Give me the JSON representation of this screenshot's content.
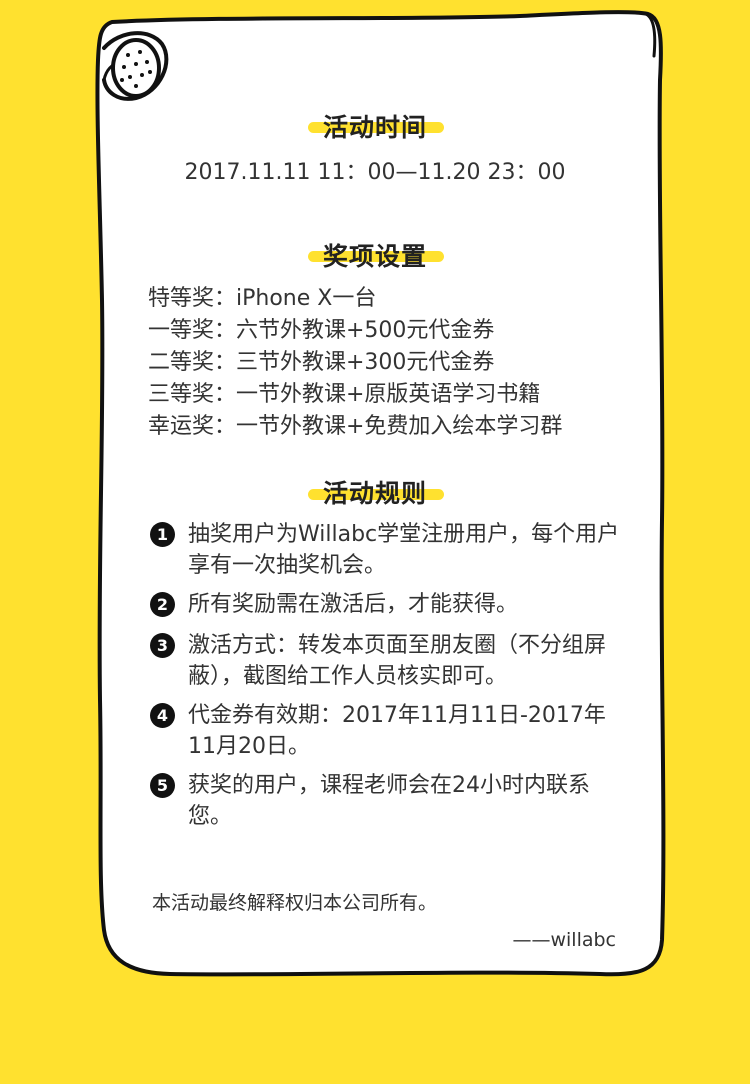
{
  "colors": {
    "background": "#FFE12F",
    "paper": "#FFFFFF",
    "ink": "#111111",
    "highlight": "#FFE12F"
  },
  "sections": {
    "time": {
      "title": "活动时间",
      "value": "2017.11.11 11：00—11.20 23：00"
    },
    "prizes": {
      "title": "奖项设置",
      "items": [
        "特等奖：iPhone X一台",
        "一等奖：六节外教课+500元代金券",
        "二等奖：三节外教课+300元代金券",
        "三等奖：一节外教课+原版英语学习书籍",
        "幸运奖：一节外教课+免费加入绘本学习群"
      ]
    },
    "rules": {
      "title": "活动规则",
      "items": [
        {
          "num": "1",
          "text": "抽奖用户为Willabc学堂注册用户，每个用户享有一次抽奖机会。"
        },
        {
          "num": "2",
          "text": "所有奖励需在激活后，才能获得。"
        },
        {
          "num": "3",
          "text": "激活方式：转发本页面至朋友圈（不分组屏蔽），截图给工作人员核实即可。"
        },
        {
          "num": "4",
          "text": "代金券有效期：2017年11月11日-2017年11月20日。"
        },
        {
          "num": "5",
          "text": "获奖的用户，课程老师会在24小时内联系您。"
        }
      ]
    }
  },
  "footer": {
    "disclaimer": "本活动最终解释权归本公司所有。",
    "signature": "——willabc"
  }
}
